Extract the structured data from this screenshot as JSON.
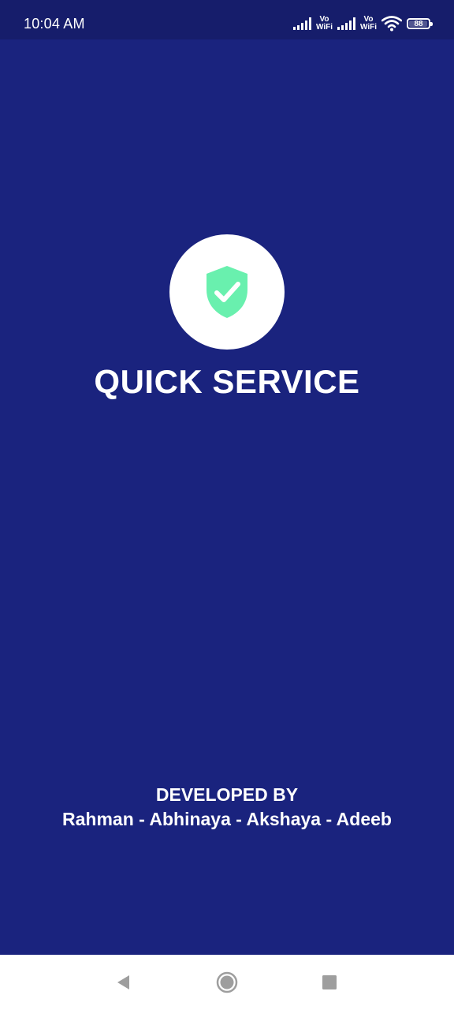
{
  "status_bar": {
    "time": "10:04 AM",
    "vowifi_top": "Vo",
    "vowifi_bottom": "WiFi",
    "battery_level": "88"
  },
  "splash": {
    "logo_icon": "shield-check-icon",
    "title": "QUICK SERVICE",
    "developed_by_label": "DEVELOPED BY",
    "developers": "Rahman - Abhinaya - Akshaya - Adeeb"
  },
  "nav_bar": {
    "back_icon": "back-triangle-icon",
    "home_icon": "home-circle-icon",
    "recents_icon": "recents-square-icon"
  },
  "colors": {
    "background": "#1a237e",
    "status_bar": "#161d6b",
    "shield": "#69f0ae",
    "text": "#ffffff"
  }
}
